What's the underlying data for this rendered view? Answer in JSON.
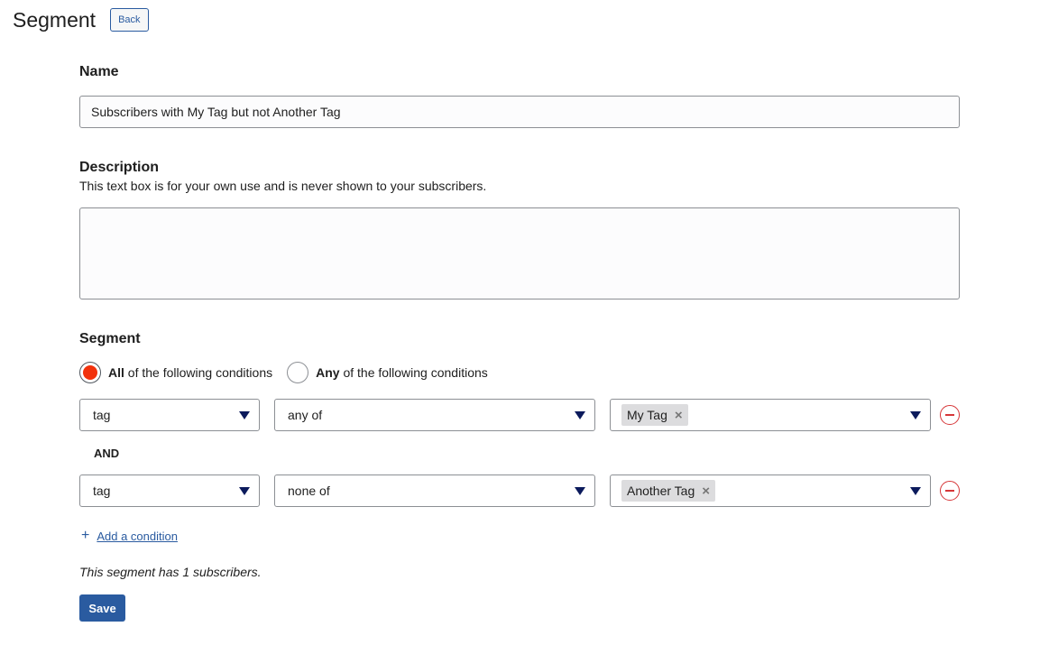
{
  "header": {
    "title": "Segment",
    "back_label": "Back"
  },
  "name": {
    "label": "Name",
    "value": "Subscribers with My Tag but not Another Tag"
  },
  "description": {
    "label": "Description",
    "help": "This text box is for your own use and is never shown to your subscribers.",
    "value": ""
  },
  "segment": {
    "label": "Segment",
    "match_all": {
      "bold": "All",
      "rest": " of the following conditions",
      "checked": true
    },
    "match_any": {
      "bold": "Any",
      "rest": " of the following conditions",
      "checked": false
    },
    "conditions": [
      {
        "field": "tag",
        "operator": "any of",
        "tags": [
          "My Tag"
        ]
      },
      {
        "field": "tag",
        "operator": "none of",
        "tags": [
          "Another Tag"
        ]
      }
    ],
    "joiner": "AND",
    "add_condition_label": "Add a condition",
    "count_text": "This segment has 1 subscribers."
  },
  "save_label": "Save",
  "colors": {
    "accent": "#2a5ba0",
    "radio_selected": "#f2320c",
    "remove": "#d63638",
    "caret": "#0b1a5c"
  },
  "icons": {
    "remove": "minus-circle-icon",
    "add": "plus-icon",
    "caret": "caret-down-icon",
    "chip_remove": "close-icon"
  }
}
